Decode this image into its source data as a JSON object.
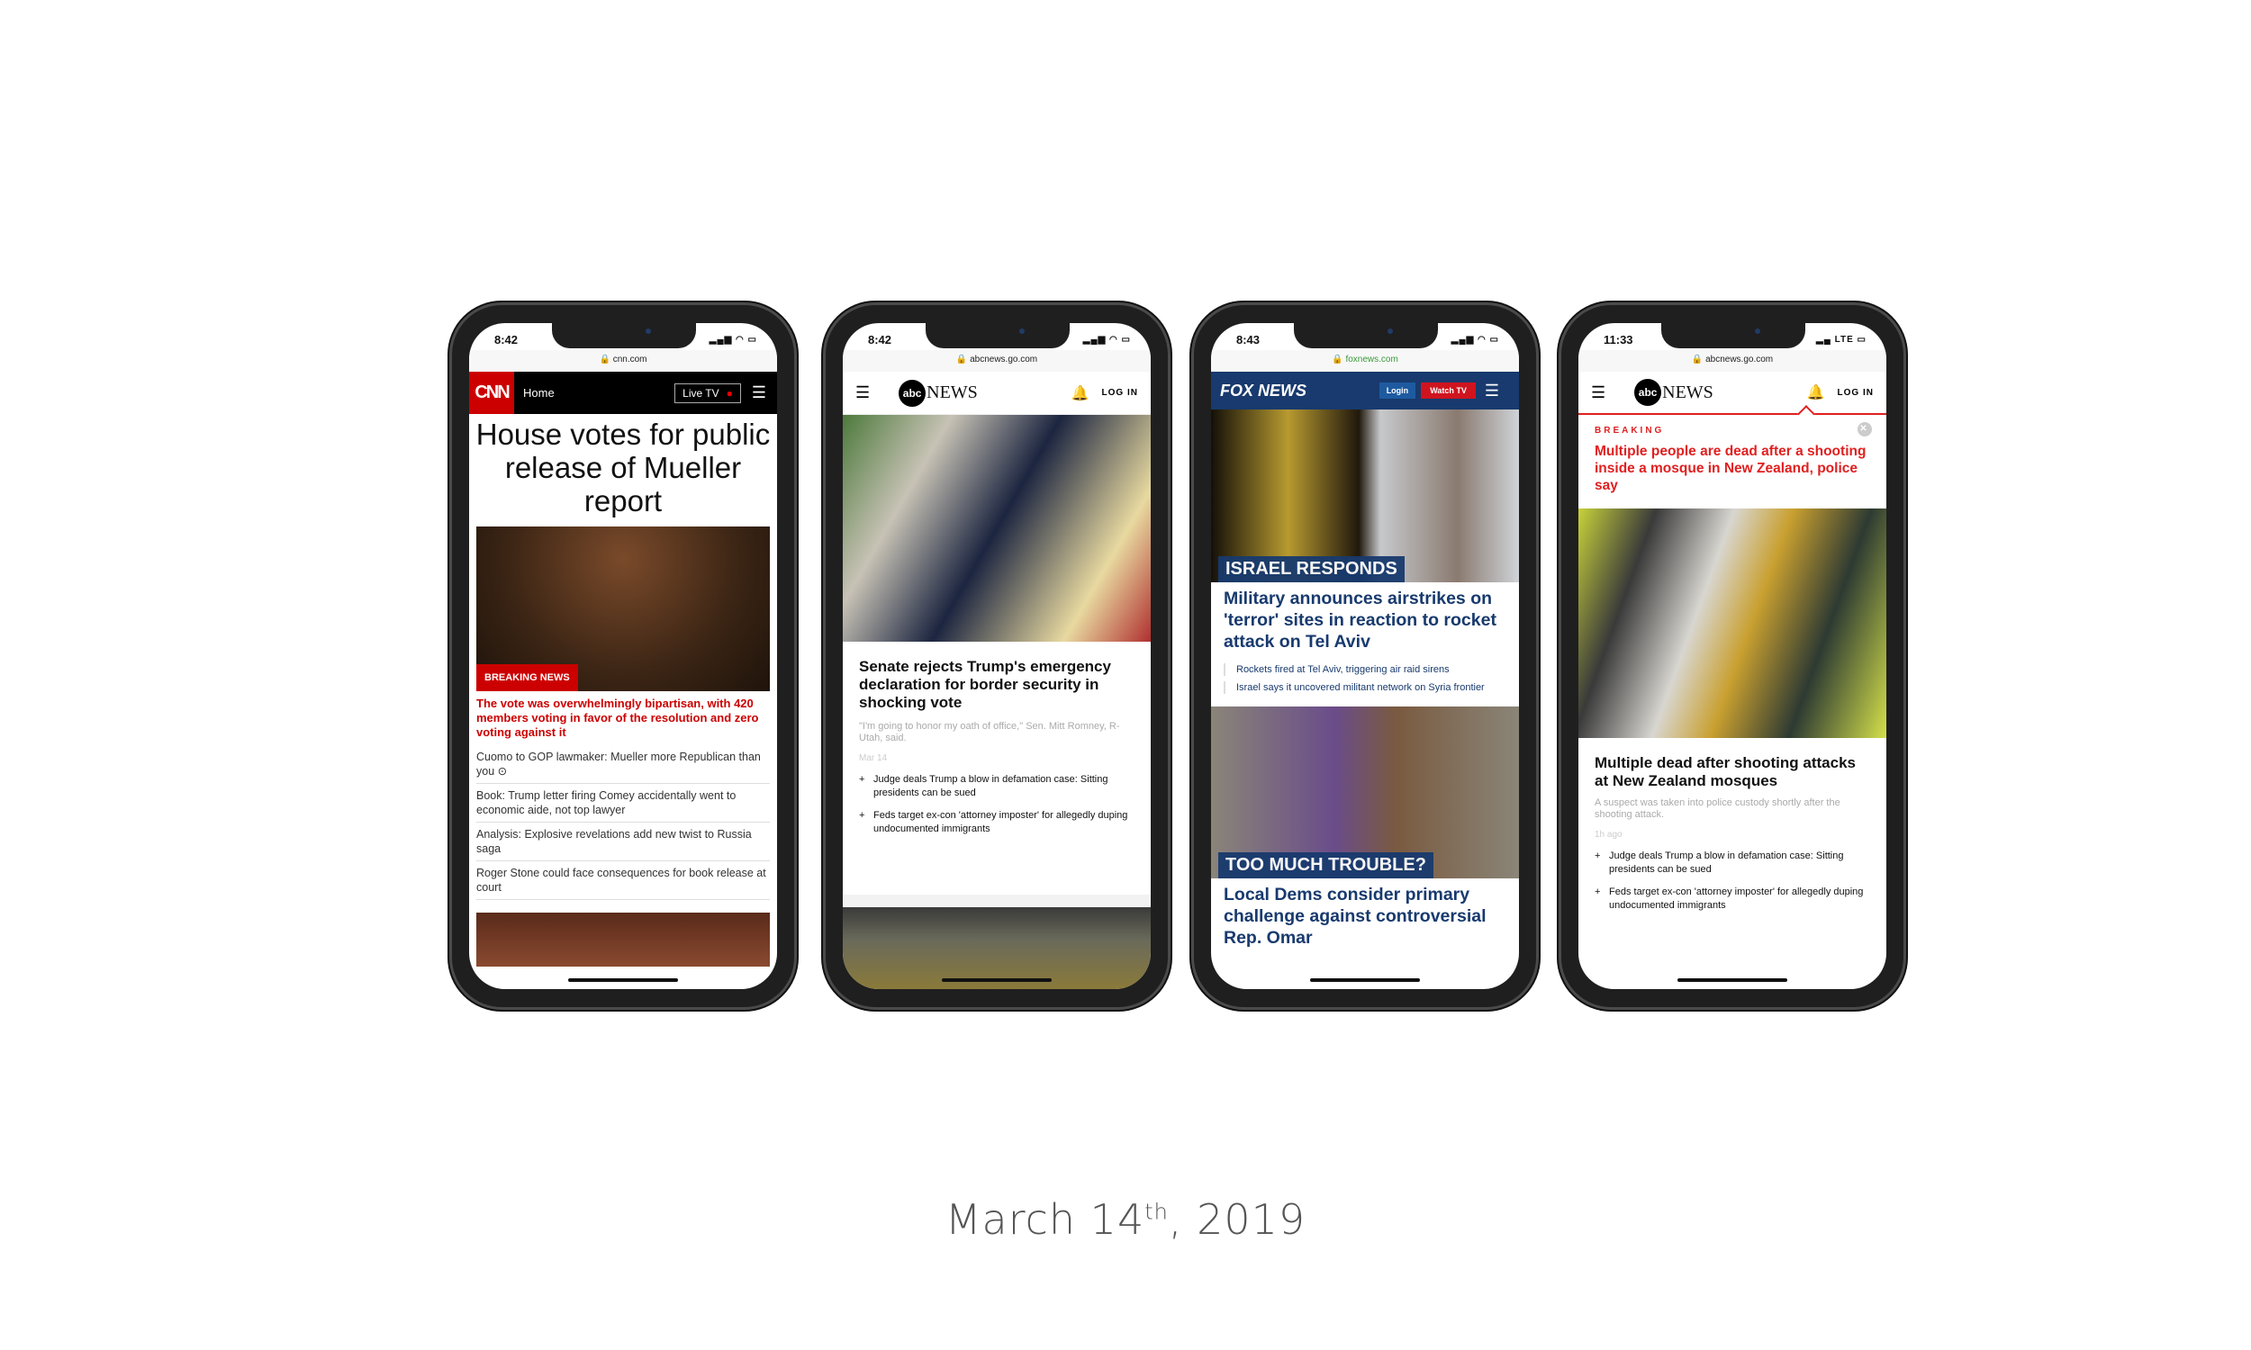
{
  "caption": {
    "month_day": "March 14",
    "suffix": "th",
    "year": ", 2019"
  },
  "phones": [
    {
      "time": "8:42",
      "url": "cnn.com",
      "logo": "CNN",
      "nav_home": "Home",
      "live_tv": "Live TV",
      "headline": "House votes for public release of Mueller report",
      "badge": "BREAKING NEWS",
      "red_text": "The vote was overwhelmingly bipartisan, with 420 members voting in favor of the resolution and zero voting against it",
      "items": [
        "Cuomo to GOP lawmaker: Mueller more Republican than you ⊙",
        "Book: Trump letter firing Comey accidentally went to economic aide, not top lawyer",
        "Analysis: Explosive revelations add new twist to Russia saga",
        "Roger Stone could face consequences for book release at court"
      ]
    },
    {
      "time": "8:42",
      "url": "abcnews.go.com",
      "logo_circle": "abc",
      "logo_text": "NEWS",
      "login": "LOG IN",
      "headline": "Senate rejects Trump's emergency declaration for border security in shocking vote",
      "sub": "\"I'm going to honor my oath of office,\" Sen. Mitt Romney, R-Utah, said.",
      "date": "Mar 14",
      "bullets": [
        "Judge deals Trump a blow in defamation case: Sitting presidents can be sued",
        "Feds target ex-con 'attorney imposter' for allegedly duping undocumented immigrants"
      ]
    },
    {
      "time": "8:43",
      "url": "foxnews.com",
      "logo": "FOX NEWS",
      "login": "Login",
      "watch": "Watch TV",
      "label1": "ISRAEL RESPONDS",
      "headline1": "Military announces airstrikes on 'terror' sites in reaction to rocket attack on Tel Aviv",
      "subs": [
        "Rockets fired at Tel Aviv, triggering air raid sirens",
        "Israel says it uncovered militant network on Syria frontier"
      ],
      "label2": "TOO MUCH TROUBLE?",
      "headline2": "Local Dems consider primary challenge against controversial Rep. Omar"
    },
    {
      "time": "11:33",
      "network": "LTE",
      "url": "abcnews.go.com",
      "logo_circle": "abc",
      "logo_text": "NEWS",
      "login": "LOG IN",
      "breaking": "BREAKING",
      "breaking_text": "Multiple people are dead after a shooting inside a mosque in New Zealand, police say",
      "headline": "Multiple dead after shooting attacks at New Zealand mosques",
      "sub": "A suspect was taken into police custody shortly after the shooting attack.",
      "date": "1h ago",
      "bullets": [
        "Judge deals Trump a blow in defamation case: Sitting presidents can be sued",
        "Feds target ex-con 'attorney imposter' for allegedly duping undocumented immigrants"
      ]
    }
  ],
  "colors": {
    "cnn_red": "#cc0000",
    "fox_blue": "#183a6e",
    "fox_red": "#d0141e",
    "abc_red": "#e02020"
  }
}
